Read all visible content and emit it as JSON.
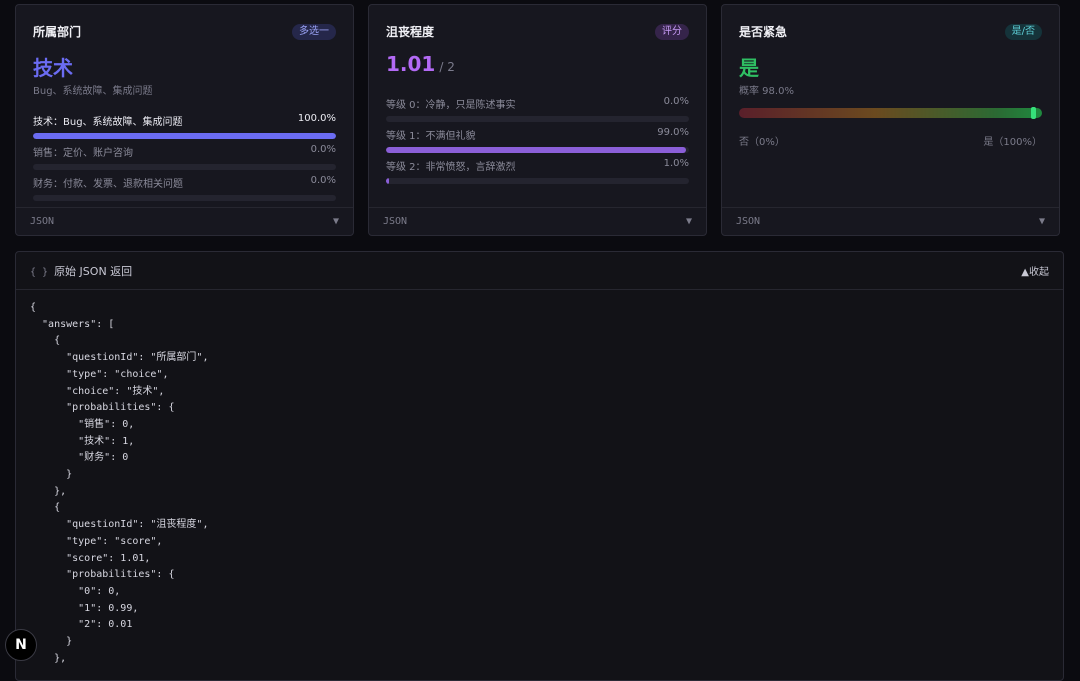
{
  "cards": [
    {
      "title": "所属部门",
      "badge": "多选一",
      "value": "技术",
      "description": "Bug、系统故障、集成问题",
      "options": [
        {
          "label": "技术：Bug、系统故障、集成问题",
          "percent_text": "100.0%",
          "fraction": 1.0
        },
        {
          "label": "销售：定价、账户咨询",
          "percent_text": "0.0%",
          "fraction": 0.0
        },
        {
          "label": "财务：付款、发票、退款相关问题",
          "percent_text": "0.0%",
          "fraction": 0.0
        }
      ],
      "footer_label": "JSON",
      "footer_icon": "▼"
    },
    {
      "title": "沮丧程度",
      "badge": "评分",
      "value": "1.01",
      "value_suffix": "/ 2",
      "options": [
        {
          "label": "等级 0：冷静，只是陈述事实",
          "percent_text": "0.0%",
          "fraction": 0.0
        },
        {
          "label": "等级 1：不满但礼貌",
          "percent_text": "99.0%",
          "fraction": 0.99
        },
        {
          "label": "等级 2：非常愤怒，言辞激烈",
          "percent_text": "1.0%",
          "fraction": 0.01
        }
      ],
      "footer_label": "JSON",
      "footer_icon": "▼"
    },
    {
      "title": "是否紧急",
      "badge": "是/否",
      "value": "是",
      "probability_text": "概率 98.0%",
      "probability": 0.98,
      "scale_left": "否（0%）",
      "scale_right": "是（100%）",
      "footer_label": "JSON",
      "footer_icon": "▼"
    }
  ],
  "json_panel": {
    "brace_icon": "{ }",
    "title": "原始 JSON 返回",
    "collapse_label": "▲收起",
    "code_lines": [
      "{",
      "  \"answers\": [",
      "    {",
      "      \"questionId\": \"所属部门\",",
      "      \"type\": \"choice\",",
      "      \"choice\": \"技术\",",
      "      \"probabilities\": {",
      "        \"销售\": 0,",
      "        \"技术\": 1,",
      "        \"财务\": 0",
      "      }",
      "    },",
      "    {",
      "      \"questionId\": \"沮丧程度\",",
      "      \"type\": \"score\",",
      "      \"score\": 1.01,",
      "      \"probabilities\": {",
      "        \"0\": 0,",
      "        \"1\": 0.99,",
      "        \"2\": 0.01",
      "      }",
      "    },"
    ]
  },
  "next_badge": "N"
}
